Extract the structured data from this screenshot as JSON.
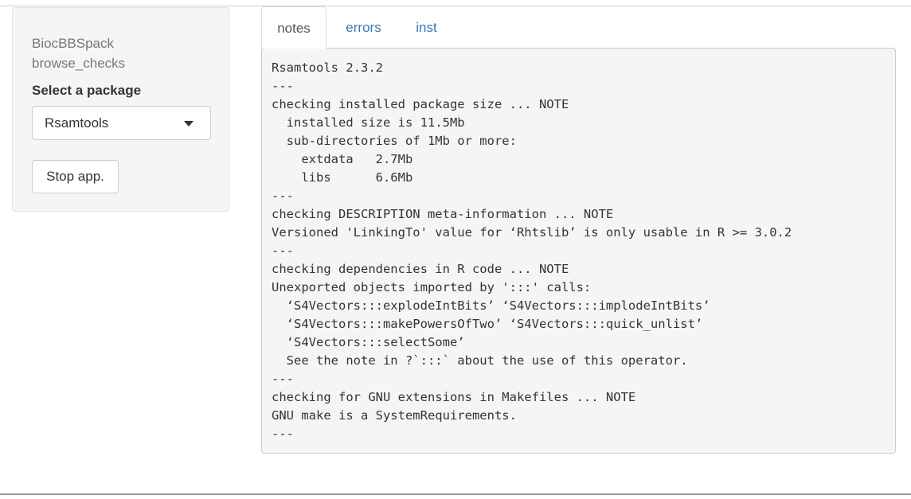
{
  "sidebar": {
    "app_title": "BiocBBSpack\nbrowse_checks",
    "select_label": "Select a package",
    "select_value": "Rsamtools",
    "stop_button_label": "Stop app."
  },
  "tabs": [
    {
      "label": "notes",
      "active": true
    },
    {
      "label": "errors",
      "active": false
    },
    {
      "label": "inst",
      "active": false
    }
  ],
  "output": {
    "text": "Rsamtools 2.3.2\n---\nchecking installed package size ... NOTE\n  installed size is 11.5Mb\n  sub-directories of 1Mb or more:\n    extdata   2.7Mb\n    libs      6.6Mb\n---\nchecking DESCRIPTION meta-information ... NOTE\nVersioned 'LinkingTo' value for ‘Rhtslib’ is only usable in R >= 3.0.2\n---\nchecking dependencies in R code ... NOTE\nUnexported objects imported by ':::' calls:\n  ‘S4Vectors:::explodeIntBits’ ‘S4Vectors:::implodeIntBits’\n  ‘S4Vectors:::makePowersOfTwo’ ‘S4Vectors:::quick_unlist’\n  ‘S4Vectors:::selectSome’\n  See the note in ?`:::` about the use of this operator.\n---\nchecking for GNU extensions in Makefiles ... NOTE\nGNU make is a SystemRequirements.\n---"
  },
  "colors": {
    "link": "#337ab7",
    "sidebar_bg": "#f5f5f5",
    "output_bg": "#f5f5f5"
  }
}
